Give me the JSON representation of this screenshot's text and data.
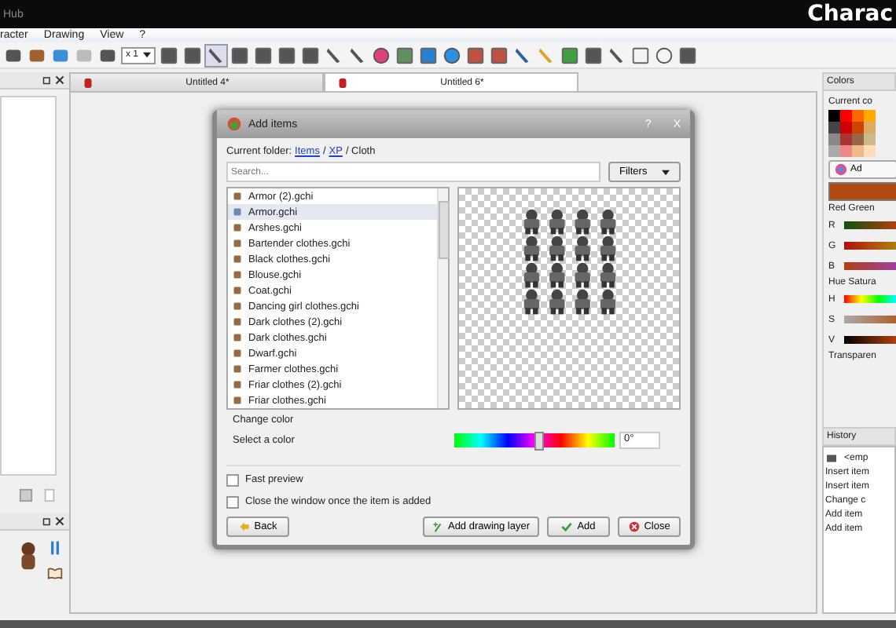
{
  "window": {
    "title": "Hub",
    "overlay_caption": "Charac"
  },
  "menu": [
    "racter",
    "Drawing",
    "View",
    "?"
  ],
  "toolbar": {
    "zoom": "x 1"
  },
  "tabs": [
    {
      "label": "Untitled 4*",
      "selected": false
    },
    {
      "label": "Untitled 6*",
      "selected": true
    }
  ],
  "colors_panel": {
    "title": "Colors",
    "current_label": "Current co",
    "add_button": "Ad",
    "rgb_label": "Red Green",
    "rgb_channels": [
      "R",
      "G",
      "B"
    ],
    "hsv_label": "Hue Satura",
    "hsv_channels": [
      "H",
      "S",
      "V"
    ],
    "transparency_label": "Transparen"
  },
  "history": {
    "title": "History",
    "items": [
      {
        "label": "<emp",
        "kind": "start"
      },
      {
        "label": "Insert item",
        "kind": "action"
      },
      {
        "label": "Insert item",
        "kind": "action"
      },
      {
        "label": "Change c",
        "kind": "action"
      },
      {
        "label": "Add item",
        "kind": "action"
      },
      {
        "label": "Add item",
        "kind": "action"
      }
    ]
  },
  "dialog": {
    "title": "Add items",
    "help": "?",
    "close": "X",
    "folder_label": "Current folder:",
    "folder_links": [
      "Items",
      "XP"
    ],
    "folder_separator": "/",
    "folder_current": "/ Cloth",
    "search": {
      "placeholder": "Search..."
    },
    "filters_button": "Filters",
    "items": [
      {
        "label": "Armor (2).gchi",
        "selected": false
      },
      {
        "label": "Armor.gchi",
        "selected": true
      },
      {
        "label": "Arshes.gchi",
        "selected": false
      },
      {
        "label": "Bartender clothes.gchi",
        "selected": false
      },
      {
        "label": "Black clothes.gchi",
        "selected": false
      },
      {
        "label": "Blouse.gchi",
        "selected": false
      },
      {
        "label": "Coat.gchi",
        "selected": false
      },
      {
        "label": "Dancing girl clothes.gchi",
        "selected": false
      },
      {
        "label": "Dark clothes (2).gchi",
        "selected": false
      },
      {
        "label": "Dark clothes.gchi",
        "selected": false
      },
      {
        "label": "Dwarf.gchi",
        "selected": false
      },
      {
        "label": "Farmer clothes.gchi",
        "selected": false
      },
      {
        "label": "Friar clothes (2).gchi",
        "selected": false
      },
      {
        "label": "Friar clothes.gchi",
        "selected": false
      }
    ],
    "change_color": {
      "title": "Change color",
      "label": "Select a color",
      "level": 0.52,
      "value": "0°"
    },
    "options": [
      {
        "label": "Fast preview",
        "checked": false
      },
      {
        "label": "Close the window once the item is added",
        "checked": false
      }
    ],
    "buttons": [
      {
        "label": "Back",
        "kind": "back"
      },
      {
        "label": "Add drawing layer",
        "kind": "layer"
      },
      {
        "label": "Add",
        "kind": "add"
      },
      {
        "label": "Close",
        "kind": "close"
      }
    ]
  }
}
